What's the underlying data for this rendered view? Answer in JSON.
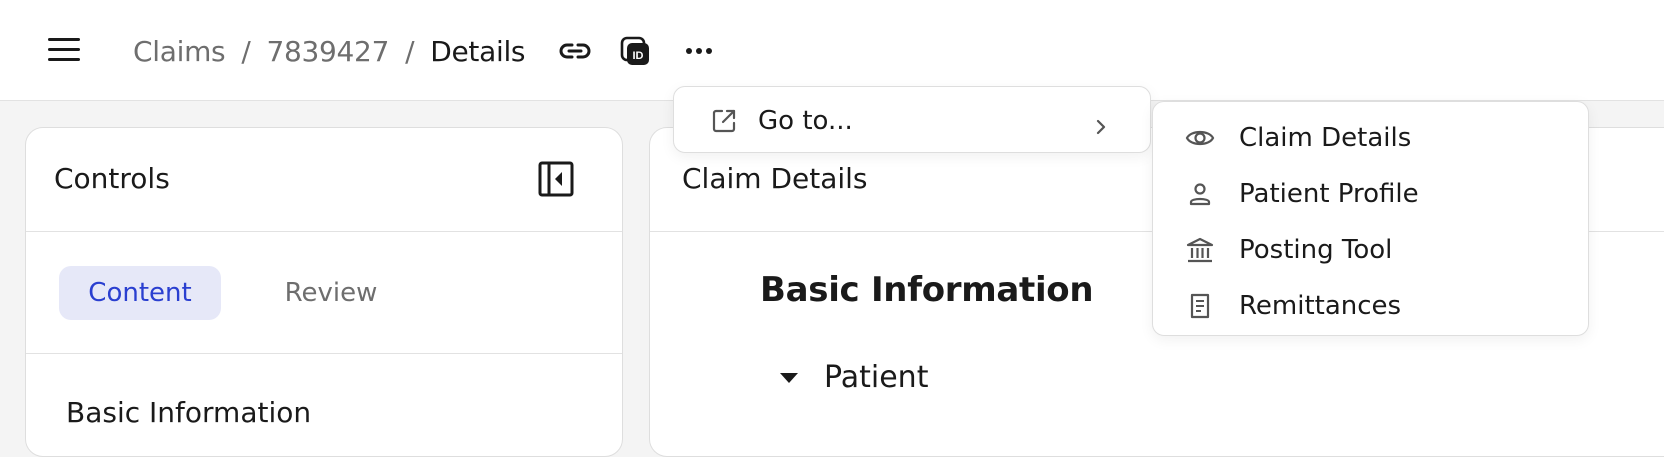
{
  "header": {
    "breadcrumb": [
      "Claims",
      "7839427",
      "Details"
    ],
    "separator": "/",
    "id_icon_text": "ID"
  },
  "left_panel": {
    "title": "Controls",
    "tabs": [
      {
        "label": "Content",
        "active": true
      },
      {
        "label": "Review",
        "active": false
      }
    ],
    "section": "Basic Information"
  },
  "right_panel": {
    "title": "Claim Details",
    "heading": "Basic Information",
    "group": "Patient"
  },
  "context_menu": {
    "item": {
      "label": "Go to...",
      "icon": "external-link-icon"
    }
  },
  "submenu": {
    "items": [
      {
        "label": "Claim Details",
        "icon": "eye-icon"
      },
      {
        "label": "Patient Profile",
        "icon": "person-icon"
      },
      {
        "label": "Posting Tool",
        "icon": "bank-icon"
      },
      {
        "label": "Remittances",
        "icon": "receipt-icon"
      }
    ]
  },
  "colors": {
    "accent": "#2a3fd0",
    "active_tab_bg": "#e6e8f8",
    "muted_text": "#6e6e6e"
  }
}
